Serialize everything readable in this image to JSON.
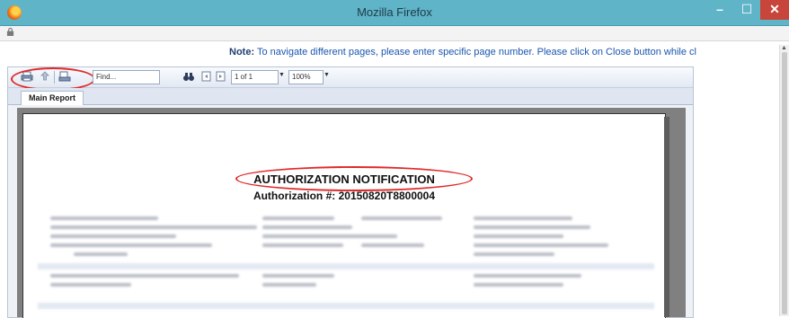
{
  "window": {
    "title": "Mozilla Firefox",
    "minimize": "–",
    "maximize": "☐",
    "close": "✕"
  },
  "page": {
    "note_label": "Note:",
    "note_text": " To navigate different pages, please enter specific page number. Please click on Close button while cl"
  },
  "toolbar": {
    "find_placeholder": "Find...",
    "page_value": "1 of 1",
    "zoom_value": "100%"
  },
  "tabs": [
    {
      "label": "Main Report"
    }
  ],
  "report": {
    "title": "AUTHORIZATION NOTIFICATION",
    "auth_number": "Authorization #: 20150820T8800004"
  },
  "colors": {
    "titlebar": "#5fb4c8",
    "note_text": "#1a56b0",
    "highlight": "#e02a2a",
    "close_button": "#c7453a"
  },
  "icons": [
    "firefox-logo-icon",
    "lock-icon",
    "print-icon",
    "export-icon",
    "print-layout-icon",
    "binoculars-icon",
    "prev-page-icon",
    "next-page-icon"
  ]
}
